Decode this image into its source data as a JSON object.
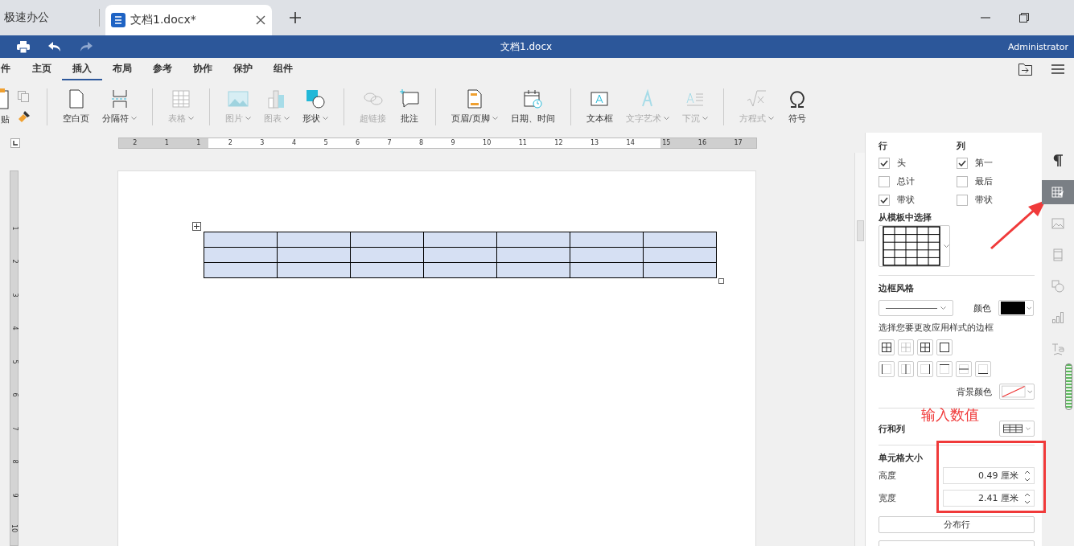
{
  "app_tab": {
    "label": "极速办公"
  },
  "document_tab": {
    "label": "文档1.docx*",
    "selected": true
  },
  "title_bar": {
    "title": "文档1.docx",
    "user": "Administrator"
  },
  "menu_tabs": [
    {
      "label": "件",
      "selected": false
    },
    {
      "label": "主页",
      "selected": false
    },
    {
      "label": "插入",
      "selected": true
    },
    {
      "label": "布局",
      "selected": false
    },
    {
      "label": "参考",
      "selected": false
    },
    {
      "label": "协作",
      "selected": false
    },
    {
      "label": "保护",
      "selected": false
    },
    {
      "label": "组件",
      "selected": false
    }
  ],
  "toolbar_groups": [
    [
      {
        "label": "贴",
        "disabled": false,
        "dropdown": false
      }
    ],
    [
      {
        "label": "空白页",
        "disabled": false,
        "dropdown": false
      },
      {
        "label": "分隔符",
        "disabled": false,
        "dropdown": true
      }
    ],
    [
      {
        "label": "表格",
        "disabled": true,
        "dropdown": true
      }
    ],
    [
      {
        "label": "图片",
        "disabled": true,
        "dropdown": true
      },
      {
        "label": "图表",
        "disabled": true,
        "dropdown": true
      },
      {
        "label": "形状",
        "disabled": false,
        "dropdown": true
      }
    ],
    [
      {
        "label": "超链接",
        "disabled": true,
        "dropdown": false
      },
      {
        "label": "批注",
        "disabled": false,
        "dropdown": false
      }
    ],
    [
      {
        "label": "页眉/页脚",
        "disabled": false,
        "dropdown": true
      },
      {
        "label": "日期、时间",
        "disabled": false,
        "dropdown": false
      }
    ],
    [
      {
        "label": "文本框",
        "disabled": false,
        "dropdown": false
      },
      {
        "label": "文字艺术",
        "disabled": true,
        "dropdown": true
      },
      {
        "label": "下沉",
        "disabled": true,
        "dropdown": true
      }
    ],
    [
      {
        "label": "方程式",
        "disabled": true,
        "dropdown": true
      },
      {
        "label": "符号",
        "disabled": false,
        "dropdown": false
      }
    ]
  ],
  "horizontal_ruler": [
    "2",
    "1",
    "1",
    "2",
    "3",
    "4",
    "5",
    "6",
    "7",
    "8",
    "9",
    "10",
    "11",
    "12",
    "13",
    "14",
    "15",
    "16",
    "17"
  ],
  "vertical_ruler": [
    "1",
    "2",
    "3",
    "4",
    "5",
    "6",
    "7",
    "8",
    "9",
    "10"
  ],
  "panel": {
    "row_heading": "行",
    "column_heading": "列",
    "row_options": [
      {
        "label": "头",
        "checked": true
      },
      {
        "label": "总计",
        "checked": false
      },
      {
        "label": "带状",
        "checked": true
      }
    ],
    "column_options": [
      {
        "label": "第一",
        "checked": true
      },
      {
        "label": "最后",
        "checked": false
      },
      {
        "label": "带状",
        "checked": false
      }
    ],
    "template_heading": "从模板中选择",
    "border_heading": "边框风格",
    "color_label": "颜色",
    "border_hint": "选择您要更改应用样式的边框",
    "background_label": "背景颜色",
    "rows_columns_label": "行和列",
    "cell_size_heading": "单元格大小",
    "height_label": "高度",
    "height_value": "0.49 厘米",
    "width_label": "宽度",
    "width_value": "2.41 厘米",
    "distribute_rows": "分布行"
  },
  "side_icons": [
    {
      "selected": false
    },
    {
      "selected": true
    },
    {
      "selected": false
    },
    {
      "selected": false
    },
    {
      "selected": false
    },
    {
      "selected": false
    },
    {
      "selected": false
    }
  ],
  "annotation": {
    "text": "输入数值"
  }
}
